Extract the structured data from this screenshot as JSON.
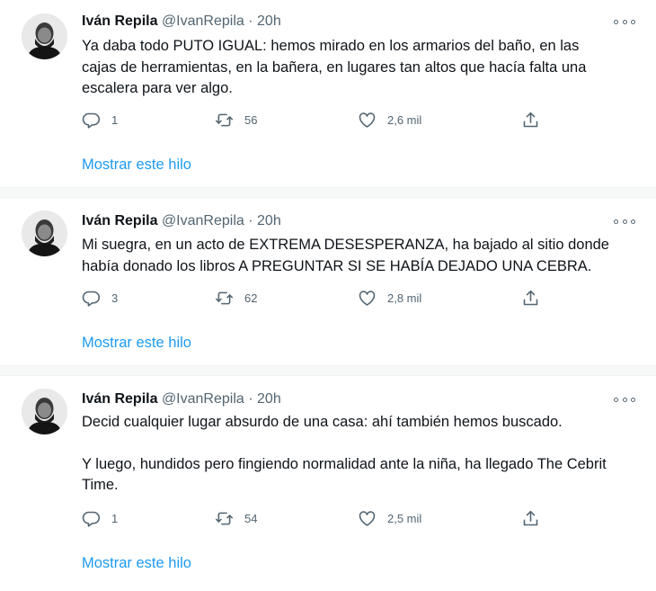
{
  "tweets": [
    {
      "author_name": "Iván Repila",
      "handle": "@IvanRepila",
      "separator": "·",
      "time": "20h",
      "text_lines": [
        "Ya daba todo PUTO IGUAL: hemos mirado en los armarios del baño, en las",
        "cajas de herramientas, en la bañera, en lugares tan altos que hacía falta una",
        "escalera para ver algo."
      ],
      "replies": "1",
      "retweets": "56",
      "likes": "2,6 mil",
      "thread_link": "Mostrar este hilo"
    },
    {
      "author_name": "Iván Repila",
      "handle": "@IvanRepila",
      "separator": "·",
      "time": "20h",
      "text_lines": [
        "Mi suegra, en un acto de EXTREMA DESESPERANZA, ha bajado al sitio donde",
        "había donado los libros A PREGUNTAR SI SE HABÍA DEJADO UNA CEBRA."
      ],
      "replies": "3",
      "retweets": "62",
      "likes": "2,8 mil",
      "thread_link": "Mostrar este hilo"
    },
    {
      "author_name": "Iván Repila",
      "handle": "@IvanRepila",
      "separator": "·",
      "time": "20h",
      "paragraphs": [
        "Decid cualquier lugar absurdo de una casa: ahí también hemos buscado.",
        "Y luego, hundidos pero fingiendo normalidad ante la niña, ha llegado The Cebrit Time."
      ],
      "replies": "1",
      "retweets": "54",
      "likes": "2,5 mil",
      "thread_link": "Mostrar este hilo"
    }
  ],
  "icons": {
    "reply": "reply-icon",
    "retweet": "retweet-icon",
    "like": "like-icon",
    "share": "share-icon",
    "more": "more-icon"
  },
  "colors": {
    "link": "#1d9bf0",
    "secondary_text": "#536471",
    "primary_text": "#0f1419",
    "separator_bg": "#f7f9f9"
  }
}
